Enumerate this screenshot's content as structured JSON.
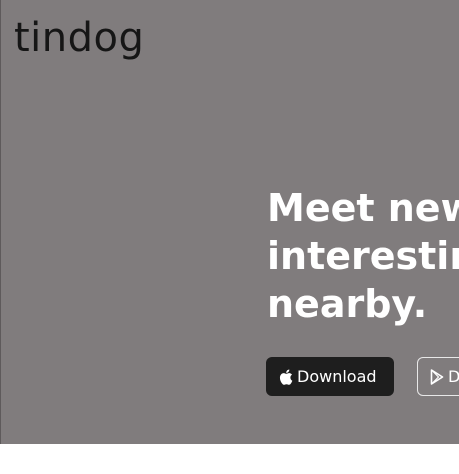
{
  "header": {
    "brand": "tindog"
  },
  "hero": {
    "headline_lines": [
      "Meet new",
      "interesting",
      "nearby."
    ],
    "buttons": [
      {
        "label": "Download",
        "icon": "apple-icon"
      },
      {
        "label": "Download",
        "icon": "google-play-icon"
      }
    ]
  },
  "colors": {
    "hero_background": "#807c7d",
    "apple_button": "#1e1e1e",
    "text_light": "#ffffff",
    "brand_text": "#161616"
  }
}
